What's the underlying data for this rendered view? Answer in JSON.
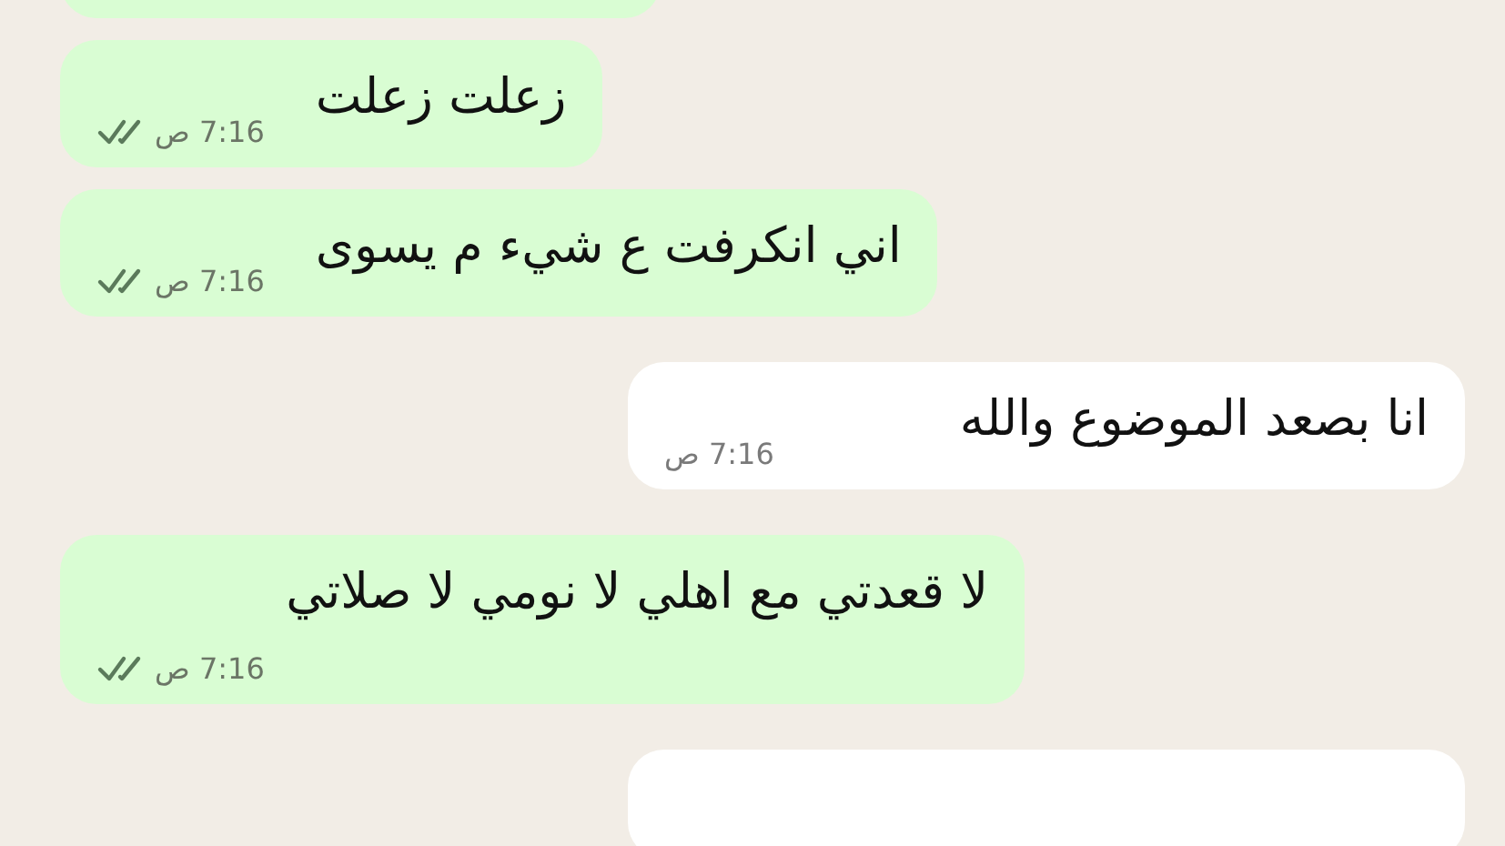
{
  "messages": [
    {
      "kind": "sent"
    },
    {
      "kind": "sent",
      "text": "زعلت زعلت",
      "time": "7:16 ص",
      "read": false
    },
    {
      "kind": "sent",
      "text": "اني انكرفت ع شيء م يسوى",
      "time": "7:16 ص",
      "read": false
    },
    {
      "kind": "received",
      "text": "انا بصعد الموضوع والله",
      "time": "7:16 ص"
    },
    {
      "kind": "sent",
      "text": "لا قعدتي مع اهلي لا نومي لا صلاتي",
      "time": "7:16 ص",
      "read": false
    },
    {
      "kind": "received"
    }
  ]
}
